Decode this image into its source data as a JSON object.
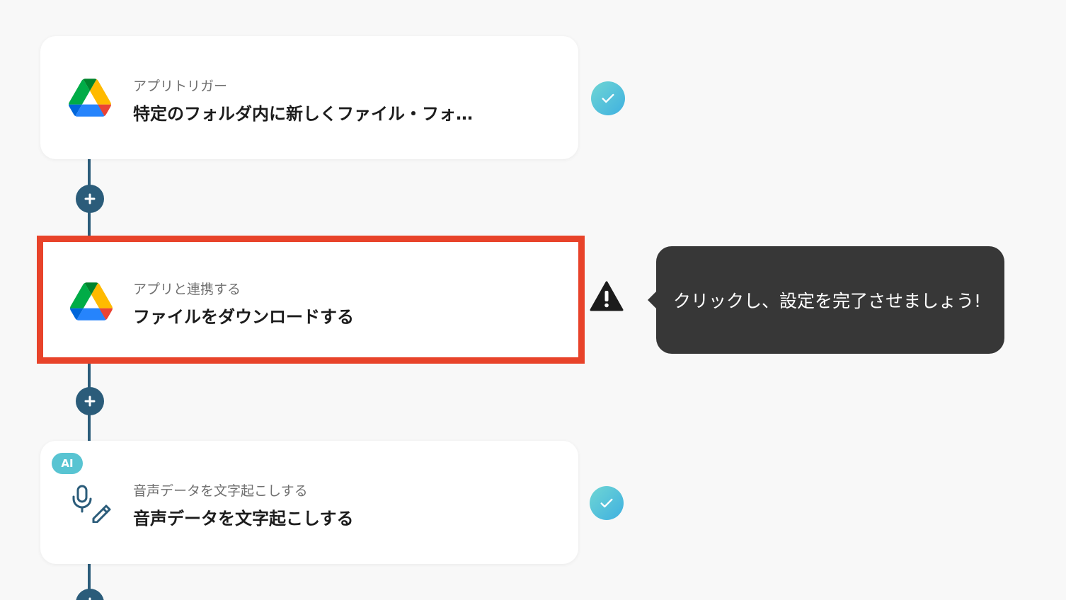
{
  "flow": {
    "steps": [
      {
        "app_label": "アプリトリガー",
        "title": "特定のフォルダ内に新しくファイル・フォ…",
        "icon": "google-drive-icon",
        "status": "complete"
      },
      {
        "app_label": "アプリと連携する",
        "title": "ファイルをダウンロードする",
        "icon": "google-drive-icon",
        "status": "warning"
      },
      {
        "badge": "AI",
        "app_label": "音声データを文字起こしする",
        "title": "音声データを文字起こしする",
        "icon": "microphone-pen-icon",
        "status": "complete"
      }
    ]
  },
  "tooltip": {
    "text": "クリックし、設定を完了させましょう!"
  },
  "colors": {
    "connector": "#2b5c7a",
    "highlight_border": "#e8432a",
    "check_gradient_start": "#6fd6d4",
    "check_gradient_end": "#3fb0e0",
    "tooltip_bg": "#373737",
    "ai_badge": "#58c4d2"
  }
}
